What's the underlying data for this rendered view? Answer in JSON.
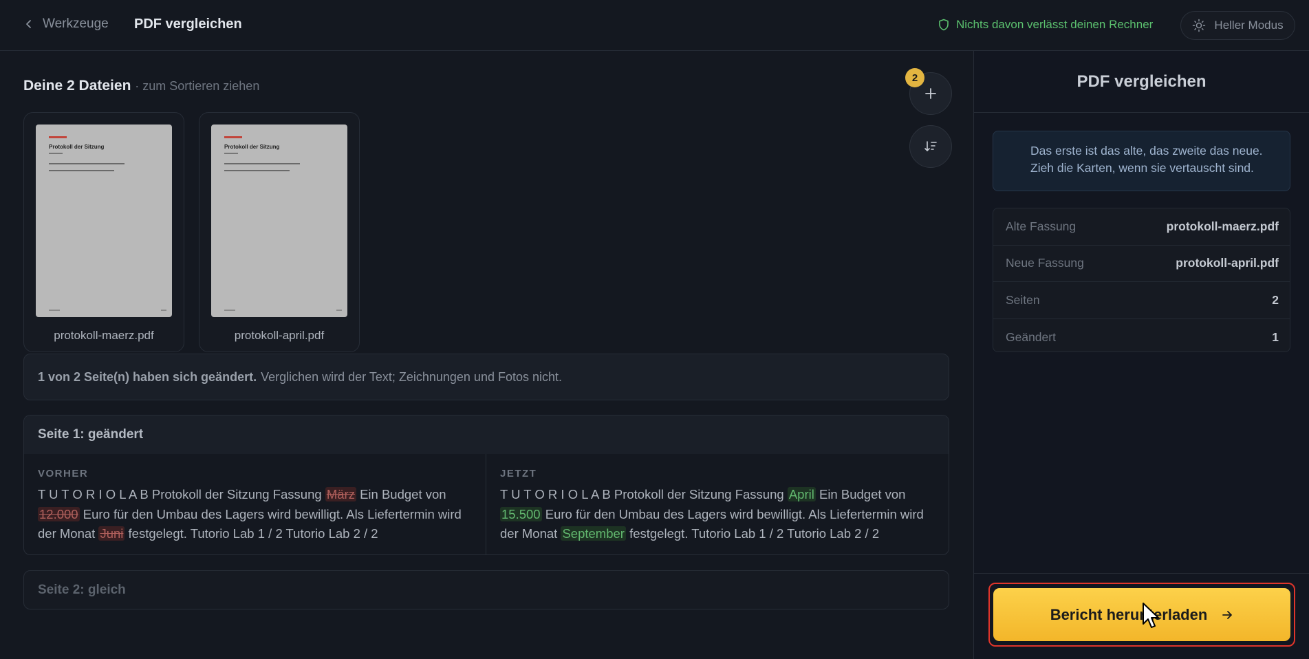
{
  "header": {
    "back_label": "Werkzeuge",
    "title": "PDF vergleichen",
    "privacy_text": "Nichts davon verlässt deinen Rechner",
    "mode_label": "Heller Modus"
  },
  "files": {
    "heading": "Deine 2 Dateien",
    "heading_sub": "· zum Sortieren ziehen",
    "count_badge": "2",
    "items": [
      {
        "name": "protokoll-maerz.pdf",
        "thumb_title": "Protokoll der Sitzung"
      },
      {
        "name": "protokoll-april.pdf",
        "thumb_title": "Protokoll der Sitzung"
      }
    ]
  },
  "summary": {
    "bold": "1 von 2 Seite(n) haben sich geändert.",
    "rest": "Verglichen wird der Text; Zeichnungen und Fotos nicht."
  },
  "pages": [
    {
      "title": "Seite 1: geändert",
      "before_label": "VORHER",
      "after_label": "JETZT",
      "before": {
        "t1": "T U T O R I O L A B Protokoll der Sitzung Fassung ",
        "d1": "März",
        "t2": " Ein Budget von ",
        "d2": "12.000",
        "t3": " Euro für den Umbau des Lagers wird bewilligt. Als Liefertermin wird der Monat ",
        "d3": "Juni",
        "t4": " festgelegt. Tutorio Lab 1 / 2 Tutorio Lab 2 / 2"
      },
      "after": {
        "t1": "T U T O R I O L A B Protokoll der Sitzung Fassung ",
        "i1": "April",
        "t2": " Ein Budget von ",
        "i2": "15.500",
        "t3": " Euro für den Umbau des Lagers wird bewilligt. Als Liefertermin wird der Monat ",
        "i3": "September",
        "t4": " festgelegt. Tutorio Lab 1 / 2 Tutorio Lab 2 / 2"
      }
    },
    {
      "title": "Seite 2: gleich"
    }
  ],
  "sidebar": {
    "title": "PDF vergleichen",
    "info": "Das erste ist das alte, das zweite das neue. Zieh die Karten, wenn sie vertauscht sind.",
    "meta": [
      {
        "key": "Alte Fassung",
        "value": "protokoll-maerz.pdf"
      },
      {
        "key": "Neue Fassung",
        "value": "protokoll-april.pdf"
      },
      {
        "key": "Seiten",
        "value": "2"
      },
      {
        "key": "Geändert",
        "value": "1"
      }
    ],
    "download_label": "Bericht herunterladen"
  },
  "colors": {
    "accent": "#f3b62a",
    "privacy_green": "#5cc26f",
    "deleted": "#b0605c",
    "inserted": "#62b86f",
    "highlight_frame": "#e0352b"
  }
}
